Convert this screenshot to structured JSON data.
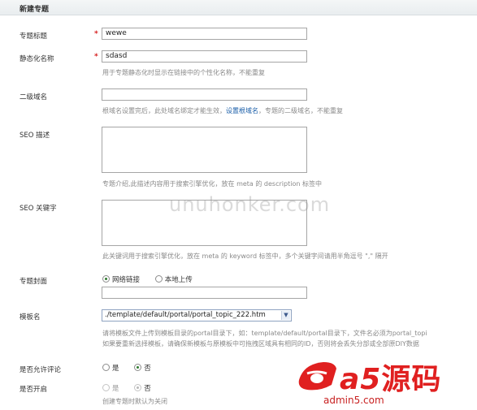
{
  "header": {
    "title": "新建专题"
  },
  "fields": {
    "title": {
      "label": "专题标题",
      "required": "*",
      "value": "wewe"
    },
    "static_name": {
      "label": "静态化名称",
      "required": "*",
      "value": "sdasd",
      "hint": "用于专题静态化时显示在链接中的个性化名称，不能重复"
    },
    "subdomain": {
      "label": "二级域名",
      "value": "",
      "hint_a": "根域名设置完后，此处域名绑定才能生效，",
      "hint_link": "设置根域名",
      "hint_b": "，专题的二级域名，不能重复"
    },
    "seo_desc": {
      "label": "SEO 描述",
      "hint": "专题介绍,此描述内容用于搜索引擎优化，放在 meta 的 description 标签中"
    },
    "seo_keywords": {
      "label": "SEO 关键字",
      "hint": "此关键词用于搜索引擎优化，放在 meta 的 keyword 标签中，多个关键字间请用半角逗号 \",\" 隔开"
    },
    "cover": {
      "label": "专题封面",
      "option_web": "网络链接",
      "option_local": "本地上传",
      "value": ""
    },
    "template": {
      "label": "模板名",
      "selected": "./template/default/portal/portal_topic_222.htm",
      "hint1": "请将模板文件上传到模板目录的portal目录下，如：template/default/portal目录下，文件名必须为portal_topi",
      "hint2": "如果要重新选择模板，请确保新模板与原模板中可拖拽区域具有相同的ID，否则将会丢失分部或全部原DIY数据"
    },
    "allow_comment": {
      "label": "是否允许评论",
      "yes": "是",
      "no": "否"
    },
    "enabled": {
      "label": "是否开启",
      "yes": "是",
      "no": "否",
      "hint": "创建专题时默认为关闭"
    }
  },
  "watermark": "unuhonker.com",
  "logo": {
    "mark": "a5",
    "cn_text": "源码",
    "domain": "admin5.com"
  },
  "colors": {
    "required": "#d61f1f",
    "link": "#1a5ea8",
    "logo_red": "#e02020"
  }
}
